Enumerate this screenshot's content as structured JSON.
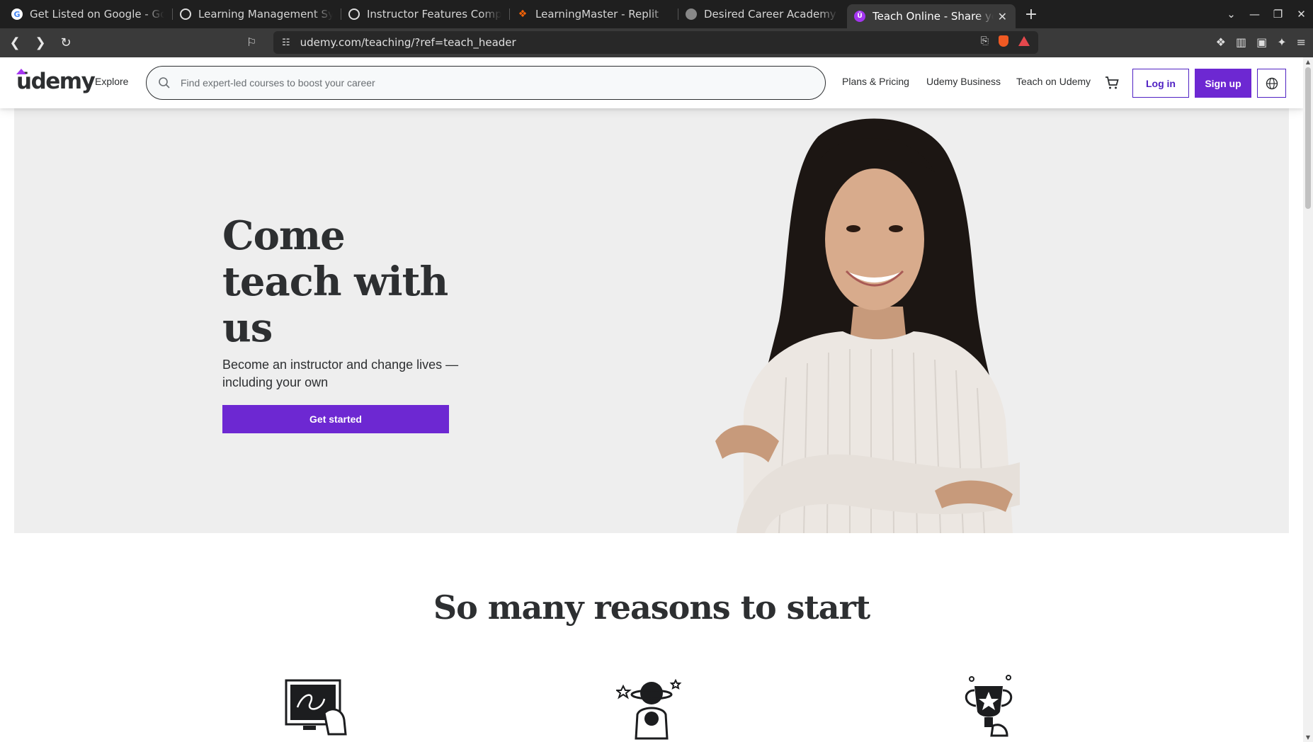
{
  "browser": {
    "tabs": [
      {
        "title": "Get Listed on Google - Goog",
        "favicon": "google-icon",
        "color": "#4285f4",
        "active": false
      },
      {
        "title": "Learning Management Syste",
        "favicon": "chatgpt-icon",
        "color": "#ffffff",
        "active": false
      },
      {
        "title": "Instructor Features Compari",
        "favicon": "chatgpt-icon",
        "color": "#ffffff",
        "active": false
      },
      {
        "title": "LearningMaster - Replit",
        "favicon": "replit-icon",
        "color": "#f26207",
        "active": false
      },
      {
        "title": "Desired Career Academy | En",
        "favicon": "globe-icon",
        "color": "#aaaaaa",
        "active": false
      },
      {
        "title": "Teach Online - Share you",
        "favicon": "udemy-icon",
        "color": "#a435f0",
        "active": true
      }
    ],
    "new_tab": "+",
    "url": "udemy.com/teaching/?ref=teach_header"
  },
  "header": {
    "logo": "ūdemy",
    "explore": "Explore",
    "search_placeholder": "Find expert-led courses to boost your career",
    "plans": "Plans & Pricing",
    "business": "Udemy Business",
    "teach": "Teach on Udemy",
    "login": "Log in",
    "signup": "Sign up"
  },
  "hero": {
    "title": "Come teach with us",
    "subtitle": "Become an instructor and change lives — including your own",
    "cta": "Get started"
  },
  "reasons": {
    "title": "So many reasons to start",
    "icons": [
      "chalkboard-icon",
      "astronaut-icon",
      "trophy-icon"
    ]
  },
  "colors": {
    "brand_purple": "#6d28d2",
    "text_dark": "#2d2f31",
    "hero_bg": "#eeeeee"
  }
}
